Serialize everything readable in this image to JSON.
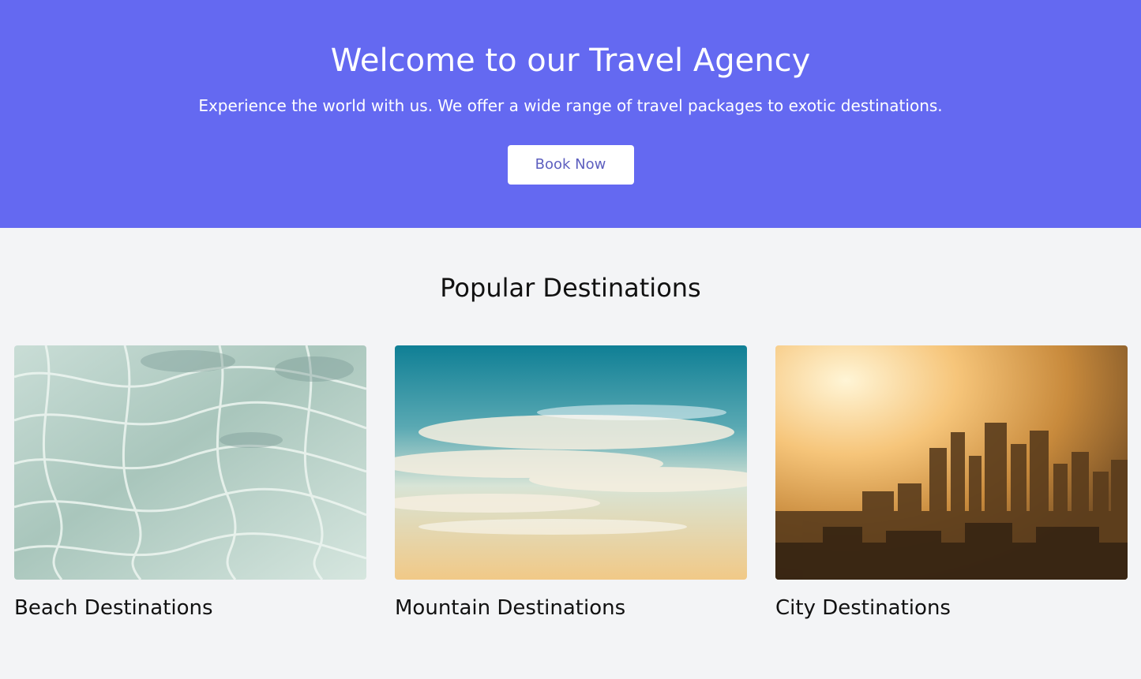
{
  "hero": {
    "title": "Welcome to our Travel Agency",
    "subtitle": "Experience the world with us. We offer a wide range of travel packages to exotic destinations.",
    "cta_label": "Book Now"
  },
  "popular": {
    "title": "Popular Destinations",
    "cards": [
      {
        "label": "Beach Destinations",
        "image": "water-ripples-photo"
      },
      {
        "label": "Mountain Destinations",
        "image": "sky-clouds-photo"
      },
      {
        "label": "City Destinations",
        "image": "city-skyline-sunset-photo"
      }
    ]
  },
  "colors": {
    "hero_bg": "#6469f1",
    "page_bg": "#f3f4f6",
    "button_text": "#5d5fbf"
  }
}
